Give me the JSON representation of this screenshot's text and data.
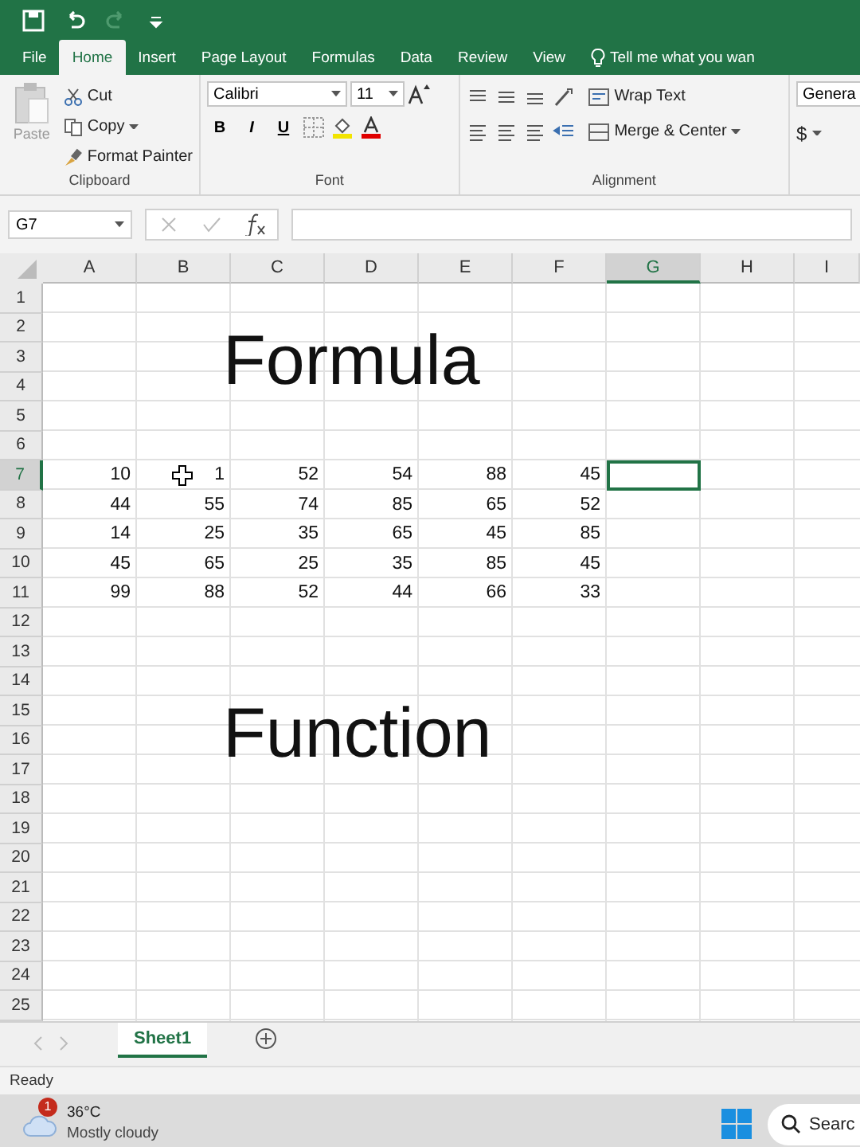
{
  "quick_access": {
    "undo_enabled": true,
    "redo_enabled": false
  },
  "tabs": [
    {
      "label": "File",
      "selected": false
    },
    {
      "label": "Home",
      "selected": true
    },
    {
      "label": "Insert",
      "selected": false
    },
    {
      "label": "Page Layout",
      "selected": false
    },
    {
      "label": "Formulas",
      "selected": false
    },
    {
      "label": "Data",
      "selected": false
    },
    {
      "label": "Review",
      "selected": false
    },
    {
      "label": "View",
      "selected": false
    }
  ],
  "tell_me": "Tell me what you wan",
  "clipboard": {
    "paste": "Paste",
    "cut": "Cut",
    "copy": "Copy",
    "format_painter": "Format Painter",
    "label": "Clipboard"
  },
  "font": {
    "name": "Calibri",
    "size": "11",
    "bold": "B",
    "italic": "I",
    "underline": "U",
    "label": "Font"
  },
  "alignment": {
    "wrap_text": "Wrap Text",
    "merge_center": "Merge & Center",
    "label": "Alignment"
  },
  "number": {
    "format": "Genera",
    "currency": "$"
  },
  "name_box": "G7",
  "columns": [
    {
      "label": "A",
      "selected": false
    },
    {
      "label": "B",
      "selected": false
    },
    {
      "label": "C",
      "selected": false
    },
    {
      "label": "D",
      "selected": false
    },
    {
      "label": "E",
      "selected": false
    },
    {
      "label": "F",
      "selected": false
    },
    {
      "label": "G",
      "selected": true
    },
    {
      "label": "H",
      "selected": false
    },
    {
      "label": "I",
      "selected": false
    }
  ],
  "rows": [
    {
      "label": "1",
      "selected": false
    },
    {
      "label": "2",
      "selected": false
    },
    {
      "label": "3",
      "selected": false
    },
    {
      "label": "4",
      "selected": false
    },
    {
      "label": "5",
      "selected": false
    },
    {
      "label": "6",
      "selected": false
    },
    {
      "label": "7",
      "selected": true,
      "cells": [
        "10",
        "1",
        "52",
        "54",
        "88",
        "45"
      ]
    },
    {
      "label": "8",
      "selected": false,
      "cells": [
        "44",
        "55",
        "74",
        "85",
        "65",
        "52"
      ]
    },
    {
      "label": "9",
      "selected": false,
      "cells": [
        "14",
        "25",
        "35",
        "65",
        "45",
        "85"
      ]
    },
    {
      "label": "10",
      "selected": false,
      "cells": [
        "45",
        "65",
        "25",
        "35",
        "85",
        "45"
      ]
    },
    {
      "label": "11",
      "selected": false,
      "cells": [
        "99",
        "88",
        "52",
        "44",
        "66",
        "33"
      ]
    },
    {
      "label": "12",
      "selected": false
    },
    {
      "label": "13",
      "selected": false
    },
    {
      "label": "14",
      "selected": false
    },
    {
      "label": "15",
      "selected": false
    },
    {
      "label": "16",
      "selected": false
    },
    {
      "label": "17",
      "selected": false
    },
    {
      "label": "18",
      "selected": false
    },
    {
      "label": "19",
      "selected": false
    },
    {
      "label": "20",
      "selected": false
    },
    {
      "label": "21",
      "selected": false
    },
    {
      "label": "22",
      "selected": false
    },
    {
      "label": "23",
      "selected": false
    },
    {
      "label": "24",
      "selected": false
    },
    {
      "label": "25",
      "selected": false
    }
  ],
  "overlay_titles": [
    "Formula",
    "Function"
  ],
  "sheet_tabs": [
    {
      "label": "Sheet1",
      "selected": true
    }
  ],
  "status": "Ready",
  "taskbar": {
    "badge": "1",
    "temperature": "36°C",
    "condition": "Mostly cloudy",
    "search": "Searc"
  }
}
